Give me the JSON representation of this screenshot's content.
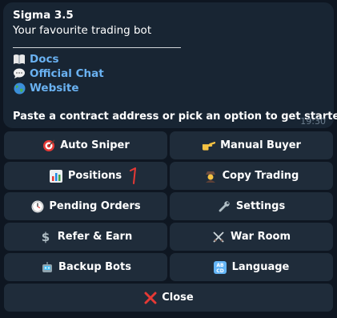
{
  "message": {
    "title": "Sigma 3.5",
    "subtitle": "Your favourite trading bot",
    "links": [
      {
        "icon": "book-icon",
        "label": "Docs"
      },
      {
        "icon": "speech-bubble-icon",
        "label": "Official Chat"
      },
      {
        "icon": "globe-icon",
        "label": "Website"
      }
    ],
    "prompt": "Paste a contract address or pick an option to get started.",
    "time": "19:30"
  },
  "keyboard": {
    "auto_sniper": "Auto Sniper",
    "manual_buyer": "Manual Buyer",
    "positions": "Positions",
    "copy_trading": "Copy Trading",
    "pending_orders": "Pending Orders",
    "settings": "Settings",
    "refer_earn": "Refer & Earn",
    "war_room": "War Room",
    "backup_bots": "Backup Bots",
    "language": "Language",
    "close": "Close"
  },
  "annotation": {
    "marker": "1",
    "color": "#e53935"
  },
  "colors": {
    "background": "#0e1621",
    "bubble": "#182533",
    "button": "#1f2c3a",
    "link": "#6ab2f2"
  }
}
